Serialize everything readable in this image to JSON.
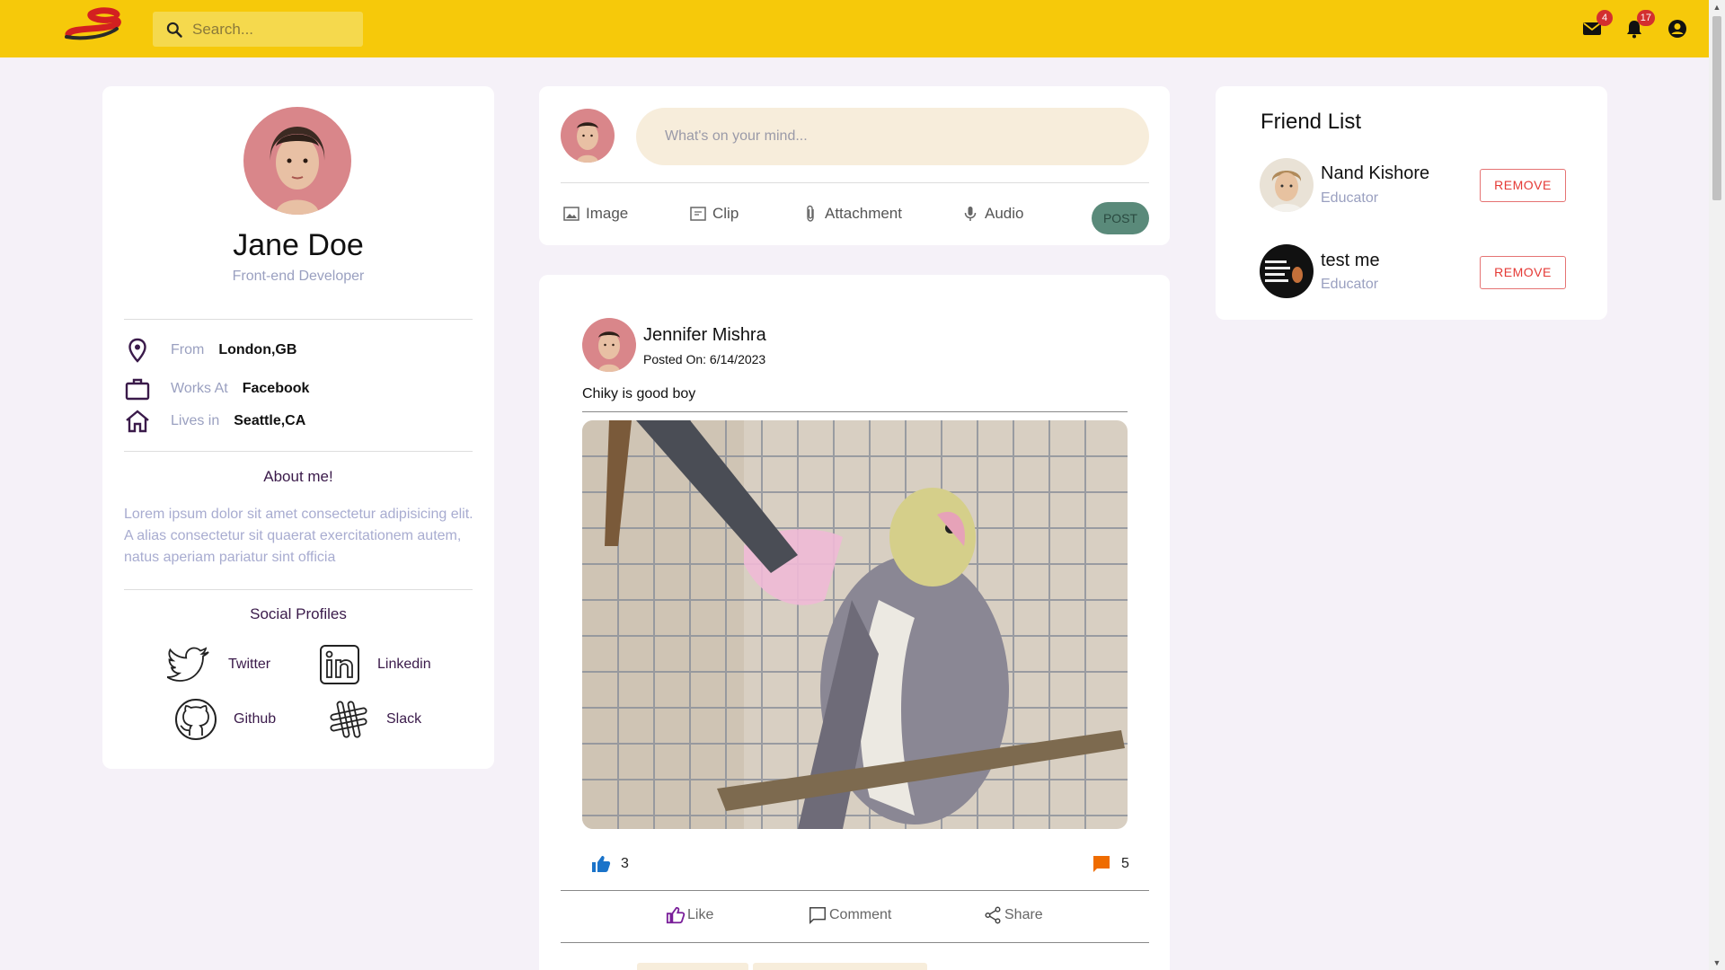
{
  "header": {
    "search_placeholder": "Search...",
    "messages_count": "4",
    "notifications_count": "17"
  },
  "profile": {
    "name": "Jane Doe",
    "role": "Front-end Developer",
    "info": [
      {
        "label": "From",
        "value": "London,GB",
        "icon": "location-pin-icon"
      },
      {
        "label": "Works At",
        "value": "Facebook",
        "icon": "briefcase-icon"
      },
      {
        "label": "Lives in",
        "value": "Seattle,CA",
        "icon": "home-icon"
      }
    ],
    "about_title": "About me!",
    "about_text": "Lorem ipsum dolor sit amet consectetur adipisicing elit. A alias consectetur sit quaerat exercitationem autem, natus aperiam pariatur sint officia",
    "social_title": "Social Profiles",
    "socials": [
      {
        "label": "Twitter",
        "icon": "twitter-icon"
      },
      {
        "label": "Linkedin",
        "icon": "linkedin-icon"
      },
      {
        "label": "Github",
        "icon": "github-icon"
      },
      {
        "label": "Slack",
        "icon": "slack-icon"
      }
    ]
  },
  "composer": {
    "placeholder": "What's on your mind...",
    "actions": [
      "Image",
      "Clip",
      "Attachment",
      "Audio"
    ],
    "post_label": "POST"
  },
  "post": {
    "author": "Jennifer Mishra",
    "date": "Posted On: 6/14/2023",
    "text": "Chiky is good boy",
    "likes": "3",
    "comments": "5",
    "actions": [
      "Like",
      "Comment",
      "Share"
    ]
  },
  "friends": {
    "title": "Friend List",
    "items": [
      {
        "name": "Nand Kishore",
        "role": "Educator",
        "action": "REMOVE"
      },
      {
        "name": "test me",
        "role": "Educator",
        "action": "REMOVE"
      }
    ]
  },
  "colors": {
    "brand": "#f6c90a",
    "accent_purple": "#3a1a4a",
    "post_button": "#5a8a7a",
    "remove_red": "#e53935"
  }
}
